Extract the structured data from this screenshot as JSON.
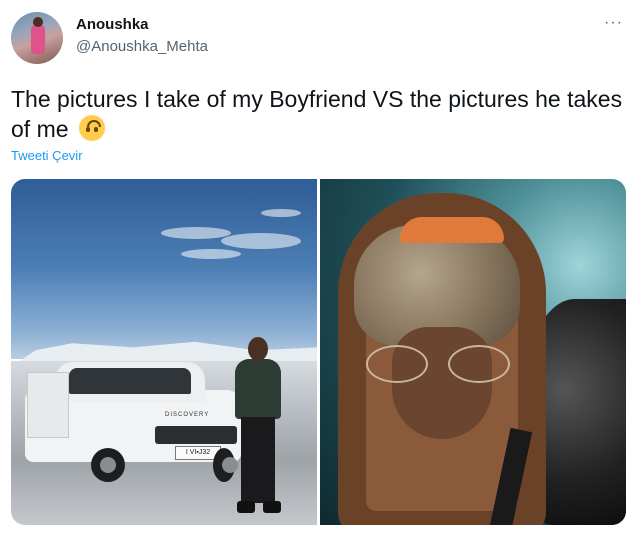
{
  "author": {
    "display_name": "Anoushka",
    "handle": "@Anoushka_Mehta"
  },
  "more_menu": {
    "glyph": "···"
  },
  "tweet": {
    "text": "The pictures I take of my Boyfriend VS the pictures he takes of me",
    "emoji": "upside-down-face-emoji"
  },
  "translate": {
    "label": "Tweeti Çevir"
  },
  "media": {
    "left": {
      "plate": "I VI▪J32",
      "badge": "DISCOVERY"
    },
    "right": {}
  },
  "colors": {
    "link": "#1d9bf0",
    "muted": "#536471",
    "text": "#0f1419"
  }
}
